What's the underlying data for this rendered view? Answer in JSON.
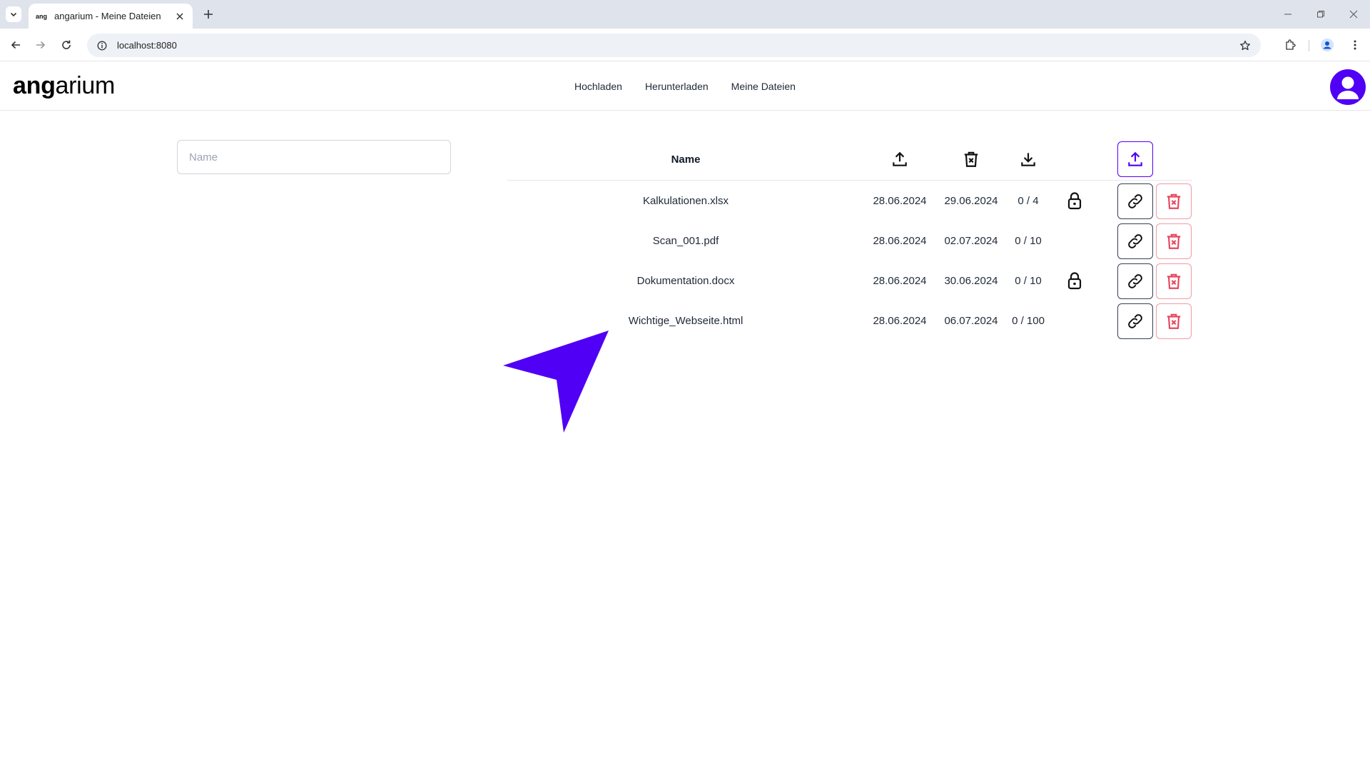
{
  "browser": {
    "tab_favicon_text": "ang",
    "tab_title": "angarium - Meine Dateien",
    "url": "localhost:8080"
  },
  "app": {
    "logo_bold": "ang",
    "logo_rest": "arium",
    "nav": [
      "Hochladen",
      "Herunterladen",
      "Meine Dateien"
    ],
    "accent_color": "#4f00f5",
    "danger_color": "#e5485f"
  },
  "search": {
    "placeholder": "Name",
    "value": ""
  },
  "table": {
    "header_name": "Name",
    "header_icons": [
      "upload-icon",
      "trash-x-icon",
      "download-icon"
    ],
    "rows": [
      {
        "name": "Kalkulationen.xlsx",
        "uploaded": "28.06.2024",
        "expires": "29.06.2024",
        "downloads": "0 / 4",
        "locked": true
      },
      {
        "name": "Scan_001.pdf",
        "uploaded": "28.06.2024",
        "expires": "02.07.2024",
        "downloads": "0 / 10",
        "locked": false
      },
      {
        "name": "Dokumentation.docx",
        "uploaded": "28.06.2024",
        "expires": "30.06.2024",
        "downloads": "0 / 10",
        "locked": true
      },
      {
        "name": "Wichtige_Webseite.html",
        "uploaded": "28.06.2024",
        "expires": "06.07.2024",
        "downloads": "0 / 100",
        "locked": false
      }
    ]
  }
}
